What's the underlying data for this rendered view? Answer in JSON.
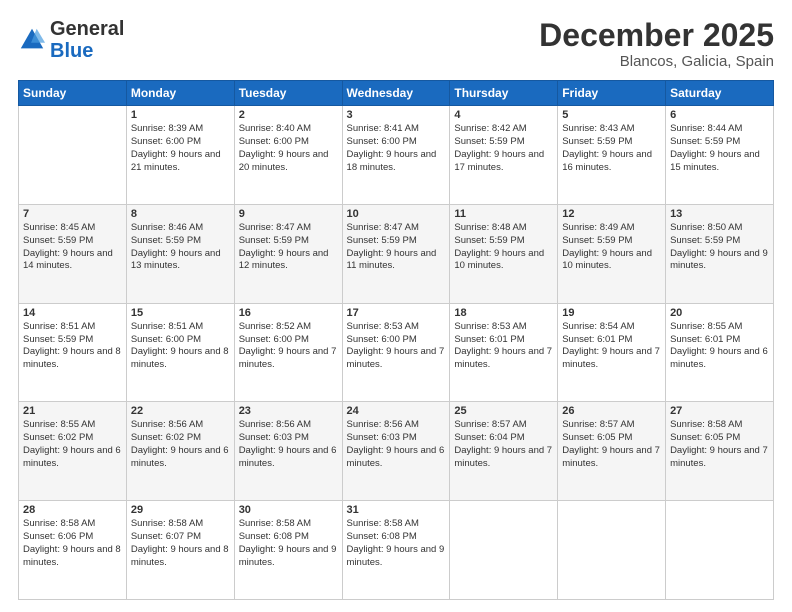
{
  "header": {
    "logo_line1": "General",
    "logo_line2": "Blue",
    "month_title": "December 2025",
    "location": "Blancos, Galicia, Spain"
  },
  "days_of_week": [
    "Sunday",
    "Monday",
    "Tuesday",
    "Wednesday",
    "Thursday",
    "Friday",
    "Saturday"
  ],
  "weeks": [
    [
      {
        "day": "",
        "sunrise": "",
        "sunset": "",
        "daylight": "",
        "empty": true
      },
      {
        "day": "1",
        "sunrise": "Sunrise: 8:39 AM",
        "sunset": "Sunset: 6:00 PM",
        "daylight": "Daylight: 9 hours and 21 minutes."
      },
      {
        "day": "2",
        "sunrise": "Sunrise: 8:40 AM",
        "sunset": "Sunset: 6:00 PM",
        "daylight": "Daylight: 9 hours and 20 minutes."
      },
      {
        "day": "3",
        "sunrise": "Sunrise: 8:41 AM",
        "sunset": "Sunset: 6:00 PM",
        "daylight": "Daylight: 9 hours and 18 minutes."
      },
      {
        "day": "4",
        "sunrise": "Sunrise: 8:42 AM",
        "sunset": "Sunset: 5:59 PM",
        "daylight": "Daylight: 9 hours and 17 minutes."
      },
      {
        "day": "5",
        "sunrise": "Sunrise: 8:43 AM",
        "sunset": "Sunset: 5:59 PM",
        "daylight": "Daylight: 9 hours and 16 minutes."
      },
      {
        "day": "6",
        "sunrise": "Sunrise: 8:44 AM",
        "sunset": "Sunset: 5:59 PM",
        "daylight": "Daylight: 9 hours and 15 minutes."
      }
    ],
    [
      {
        "day": "7",
        "sunrise": "Sunrise: 8:45 AM",
        "sunset": "Sunset: 5:59 PM",
        "daylight": "Daylight: 9 hours and 14 minutes."
      },
      {
        "day": "8",
        "sunrise": "Sunrise: 8:46 AM",
        "sunset": "Sunset: 5:59 PM",
        "daylight": "Daylight: 9 hours and 13 minutes."
      },
      {
        "day": "9",
        "sunrise": "Sunrise: 8:47 AM",
        "sunset": "Sunset: 5:59 PM",
        "daylight": "Daylight: 9 hours and 12 minutes."
      },
      {
        "day": "10",
        "sunrise": "Sunrise: 8:47 AM",
        "sunset": "Sunset: 5:59 PM",
        "daylight": "Daylight: 9 hours and 11 minutes."
      },
      {
        "day": "11",
        "sunrise": "Sunrise: 8:48 AM",
        "sunset": "Sunset: 5:59 PM",
        "daylight": "Daylight: 9 hours and 10 minutes."
      },
      {
        "day": "12",
        "sunrise": "Sunrise: 8:49 AM",
        "sunset": "Sunset: 5:59 PM",
        "daylight": "Daylight: 9 hours and 10 minutes."
      },
      {
        "day": "13",
        "sunrise": "Sunrise: 8:50 AM",
        "sunset": "Sunset: 5:59 PM",
        "daylight": "Daylight: 9 hours and 9 minutes."
      }
    ],
    [
      {
        "day": "14",
        "sunrise": "Sunrise: 8:51 AM",
        "sunset": "Sunset: 5:59 PM",
        "daylight": "Daylight: 9 hours and 8 minutes."
      },
      {
        "day": "15",
        "sunrise": "Sunrise: 8:51 AM",
        "sunset": "Sunset: 6:00 PM",
        "daylight": "Daylight: 9 hours and 8 minutes."
      },
      {
        "day": "16",
        "sunrise": "Sunrise: 8:52 AM",
        "sunset": "Sunset: 6:00 PM",
        "daylight": "Daylight: 9 hours and 7 minutes."
      },
      {
        "day": "17",
        "sunrise": "Sunrise: 8:53 AM",
        "sunset": "Sunset: 6:00 PM",
        "daylight": "Daylight: 9 hours and 7 minutes."
      },
      {
        "day": "18",
        "sunrise": "Sunrise: 8:53 AM",
        "sunset": "Sunset: 6:01 PM",
        "daylight": "Daylight: 9 hours and 7 minutes."
      },
      {
        "day": "19",
        "sunrise": "Sunrise: 8:54 AM",
        "sunset": "Sunset: 6:01 PM",
        "daylight": "Daylight: 9 hours and 7 minutes."
      },
      {
        "day": "20",
        "sunrise": "Sunrise: 8:55 AM",
        "sunset": "Sunset: 6:01 PM",
        "daylight": "Daylight: 9 hours and 6 minutes."
      }
    ],
    [
      {
        "day": "21",
        "sunrise": "Sunrise: 8:55 AM",
        "sunset": "Sunset: 6:02 PM",
        "daylight": "Daylight: 9 hours and 6 minutes."
      },
      {
        "day": "22",
        "sunrise": "Sunrise: 8:56 AM",
        "sunset": "Sunset: 6:02 PM",
        "daylight": "Daylight: 9 hours and 6 minutes."
      },
      {
        "day": "23",
        "sunrise": "Sunrise: 8:56 AM",
        "sunset": "Sunset: 6:03 PM",
        "daylight": "Daylight: 9 hours and 6 minutes."
      },
      {
        "day": "24",
        "sunrise": "Sunrise: 8:56 AM",
        "sunset": "Sunset: 6:03 PM",
        "daylight": "Daylight: 9 hours and 6 minutes."
      },
      {
        "day": "25",
        "sunrise": "Sunrise: 8:57 AM",
        "sunset": "Sunset: 6:04 PM",
        "daylight": "Daylight: 9 hours and 7 minutes."
      },
      {
        "day": "26",
        "sunrise": "Sunrise: 8:57 AM",
        "sunset": "Sunset: 6:05 PM",
        "daylight": "Daylight: 9 hours and 7 minutes."
      },
      {
        "day": "27",
        "sunrise": "Sunrise: 8:58 AM",
        "sunset": "Sunset: 6:05 PM",
        "daylight": "Daylight: 9 hours and 7 minutes."
      }
    ],
    [
      {
        "day": "28",
        "sunrise": "Sunrise: 8:58 AM",
        "sunset": "Sunset: 6:06 PM",
        "daylight": "Daylight: 9 hours and 8 minutes."
      },
      {
        "day": "29",
        "sunrise": "Sunrise: 8:58 AM",
        "sunset": "Sunset: 6:07 PM",
        "daylight": "Daylight: 9 hours and 8 minutes."
      },
      {
        "day": "30",
        "sunrise": "Sunrise: 8:58 AM",
        "sunset": "Sunset: 6:08 PM",
        "daylight": "Daylight: 9 hours and 9 minutes."
      },
      {
        "day": "31",
        "sunrise": "Sunrise: 8:58 AM",
        "sunset": "Sunset: 6:08 PM",
        "daylight": "Daylight: 9 hours and 9 minutes."
      },
      {
        "day": "",
        "sunrise": "",
        "sunset": "",
        "daylight": "",
        "empty": true
      },
      {
        "day": "",
        "sunrise": "",
        "sunset": "",
        "daylight": "",
        "empty": true
      },
      {
        "day": "",
        "sunrise": "",
        "sunset": "",
        "daylight": "",
        "empty": true
      }
    ]
  ]
}
